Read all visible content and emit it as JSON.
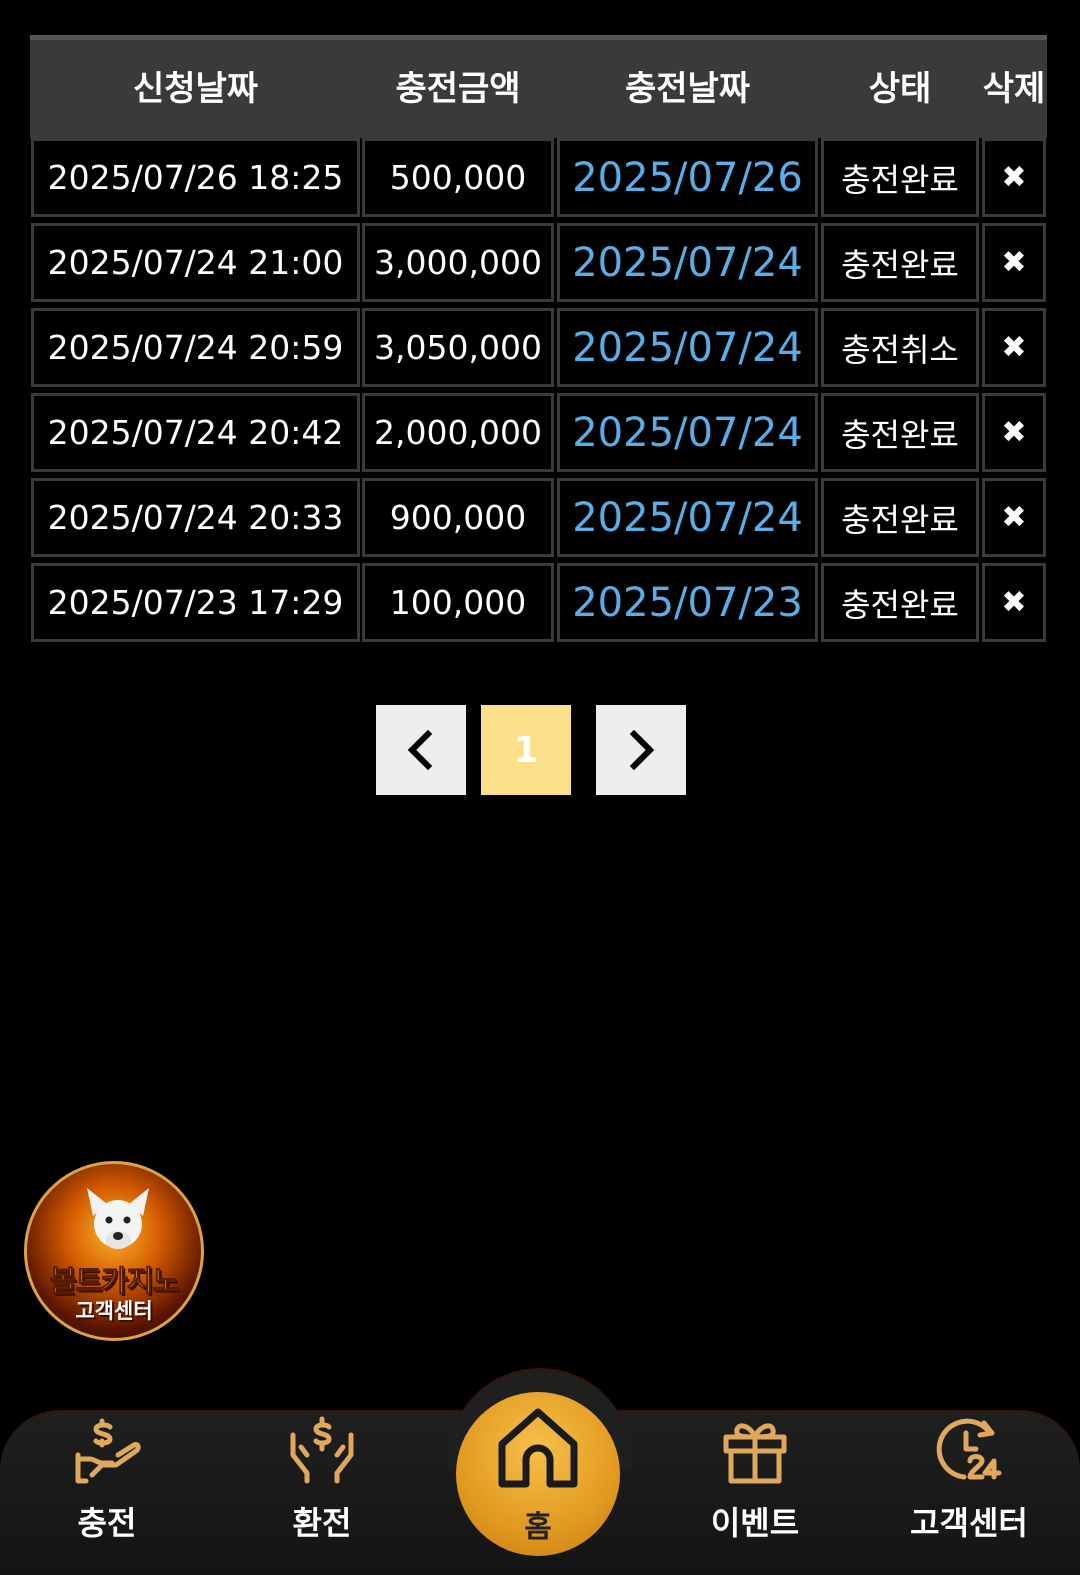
{
  "table": {
    "headers": {
      "request_date": "신청날짜",
      "amount": "충전금액",
      "charge_date": "충전날짜",
      "status": "상태",
      "delete": "삭제"
    },
    "rows": [
      {
        "request_date": "2025/07/26 18:25",
        "amount": "500,000",
        "charge_date": "2025/07/26",
        "status": "충전완료",
        "delete": "✖"
      },
      {
        "request_date": "2025/07/24 21:00",
        "amount": "3,000,000",
        "charge_date": "2025/07/24",
        "status": "충전완료",
        "delete": "✖"
      },
      {
        "request_date": "2025/07/24 20:59",
        "amount": "3,050,000",
        "charge_date": "2025/07/24",
        "status": "충전취소",
        "delete": "✖"
      },
      {
        "request_date": "2025/07/24 20:42",
        "amount": "2,000,000",
        "charge_date": "2025/07/24",
        "status": "충전완료",
        "delete": "✖"
      },
      {
        "request_date": "2025/07/24 20:33",
        "amount": "900,000",
        "charge_date": "2025/07/24",
        "status": "충전완료",
        "delete": "✖"
      },
      {
        "request_date": "2025/07/23 17:29",
        "amount": "100,000",
        "charge_date": "2025/07/23",
        "status": "충전완료",
        "delete": "✖"
      }
    ]
  },
  "pagination": {
    "prev_icon": "chevron-left-icon",
    "current_page": "1",
    "next_icon": "chevron-right-icon"
  },
  "floating_badge": {
    "title": "볼트카지노",
    "subtitle": "고객센터"
  },
  "bottom_nav": {
    "charge": {
      "label": "충전",
      "icon": "hand-coin-icon"
    },
    "exchange": {
      "label": "환전",
      "icon": "hands-dollar-icon"
    },
    "home": {
      "label": "홈",
      "icon": "home-icon"
    },
    "event": {
      "label": "이벤트",
      "icon": "gift-icon"
    },
    "support": {
      "label": "고객센터",
      "icon": "clock-24-icon"
    }
  },
  "colors": {
    "background": "#000000",
    "header_bg": "#3a3a3a",
    "date_link": "#5aaee8",
    "page_active": "#fbe08a",
    "accent_gold": "#e0a030"
  }
}
